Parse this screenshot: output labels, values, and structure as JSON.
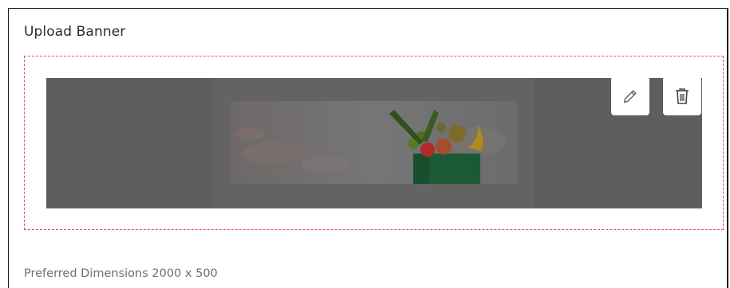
{
  "section": {
    "title": "Upload Banner",
    "hint": "Preferred Dimensions 2000 x 500"
  },
  "banner": {
    "image_description_icon": "grocery-bag-image",
    "overlay_color": "#5e5e5e",
    "border_color": "#e0506a"
  },
  "actions": {
    "edit_icon": "pencil-icon",
    "delete_icon": "trash-icon"
  }
}
